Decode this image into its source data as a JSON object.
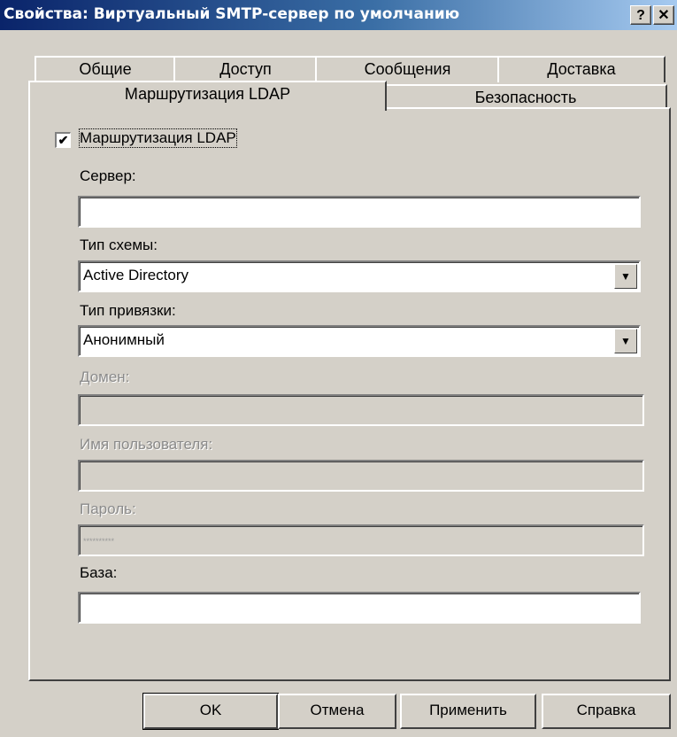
{
  "window": {
    "title": "Свойства: Виртуальный SMTP-сервер по умолчанию",
    "help_glyph": "?",
    "close_glyph": "✕"
  },
  "tabs": {
    "back_row": [
      "Общие",
      "Доступ",
      "Сообщения",
      "Доставка"
    ],
    "front_row": [
      "Маршрутизация LDAP",
      "Безопасность"
    ],
    "active": "Маршрутизация LDAP"
  },
  "ldap": {
    "enable_checkbox": {
      "label": "Маршрутизация LDAP",
      "checked": true,
      "check_glyph": "✔"
    },
    "server": {
      "label": "Сервер:",
      "value": ""
    },
    "schema": {
      "label": "Тип схемы:",
      "value": "Active Directory"
    },
    "binding": {
      "label": "Тип привязки:",
      "value": "Анонимный"
    },
    "domain": {
      "label": "Домен:",
      "value": "",
      "disabled": true
    },
    "username": {
      "label": "Имя пользователя:",
      "value": "",
      "disabled": true
    },
    "password": {
      "label": "Пароль:",
      "value": "**********",
      "disabled": true
    },
    "base": {
      "label": "База:",
      "value": ""
    },
    "dropdown_icon": "▼"
  },
  "buttons": {
    "ok": "OK",
    "cancel": "Отмена",
    "apply": "Применить",
    "help": "Справка"
  }
}
